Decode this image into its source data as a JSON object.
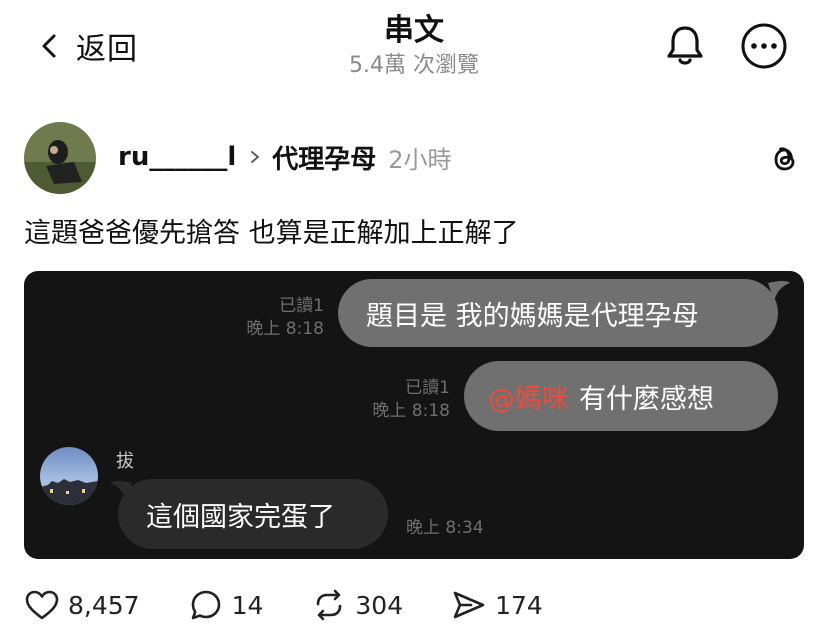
{
  "header": {
    "back_label": "返回",
    "title": "串文",
    "views": "5.4萬 次瀏覽"
  },
  "post": {
    "username": "ru______l",
    "community": "代理孕母",
    "time": "2小時",
    "text": "這題爸爸優先搶答 也算是正解加上正解了"
  },
  "chat": {
    "messages": [
      {
        "read": "已讀1",
        "time": "晚上 8:18",
        "text": "題目是 我的媽媽是代理孕母"
      },
      {
        "read": "已讀1",
        "time": "晚上 8:18",
        "mention": "@媽咪",
        "text": "有什麼感想"
      },
      {
        "sender": "拔",
        "time": "晚上 8:34",
        "text": "這個國家完蛋了"
      }
    ]
  },
  "actions": {
    "likes": "8,457",
    "comments": "14",
    "reposts": "304",
    "shares": "174"
  },
  "colors": {
    "mention": "#ef4a3a",
    "chat_bg": "#141414",
    "outgoing_bubble": "#707070",
    "incoming_bubble": "#2a2a2a"
  },
  "icons": [
    "chevron-left-icon",
    "bell-icon",
    "more-icon",
    "threads-logo-icon",
    "heart-icon",
    "comment-icon",
    "repost-icon",
    "share-icon"
  ]
}
